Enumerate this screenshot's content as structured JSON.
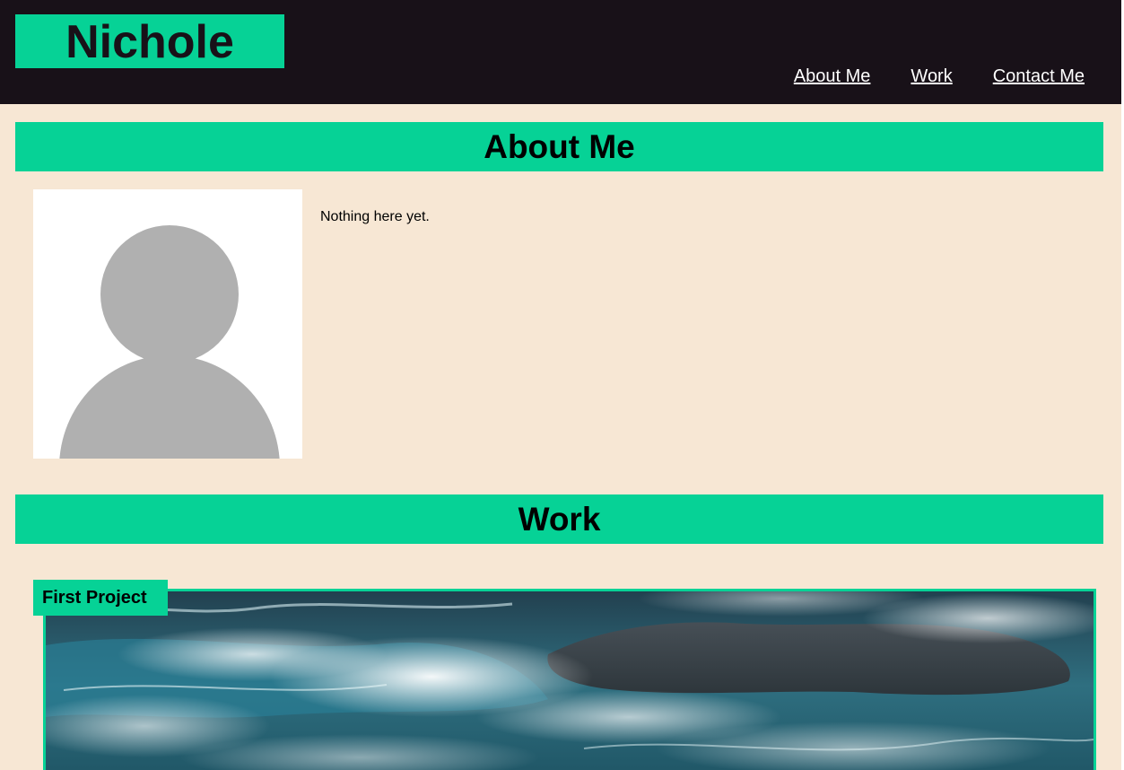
{
  "header": {
    "logo_text": "Nichole",
    "nav": [
      {
        "label": "About Me"
      },
      {
        "label": "Work"
      },
      {
        "label": "Contact Me"
      }
    ]
  },
  "about": {
    "title": "About Me",
    "text": "Nothing here yet.",
    "avatar_icon": "person-placeholder-icon"
  },
  "work": {
    "title": "Work",
    "projects": [
      {
        "label": "First Project",
        "image": "ocean-waves-image"
      }
    ]
  },
  "colors": {
    "accent": "#06d296",
    "header_bg": "#181118",
    "page_bg": "#f7e7d4",
    "avatar_gray": "#b0b0b0"
  }
}
